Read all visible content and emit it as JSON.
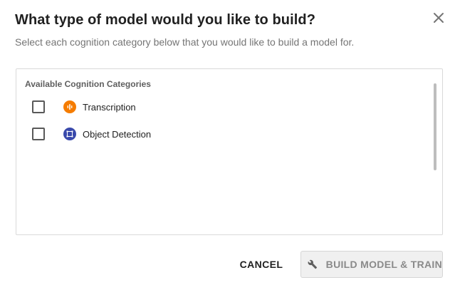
{
  "dialog": {
    "title": "What type of model would you like to build?",
    "subtitle": "Select each cognition category below that you would like to build a model for.",
    "close_icon": "close-icon"
  },
  "panel": {
    "header": "Available Cognition Categories",
    "categories": [
      {
        "label": "Transcription",
        "icon": "transcription-icon",
        "icon_color": "#f57c00",
        "checked": false
      },
      {
        "label": "Object Detection",
        "icon": "object-detection-icon",
        "icon_color": "#3949ab",
        "checked": false
      }
    ]
  },
  "actions": {
    "cancel_label": "CANCEL",
    "build_label": "BUILD MODEL & TRAIN",
    "build_icon": "wrench-icon",
    "build_disabled": true
  }
}
